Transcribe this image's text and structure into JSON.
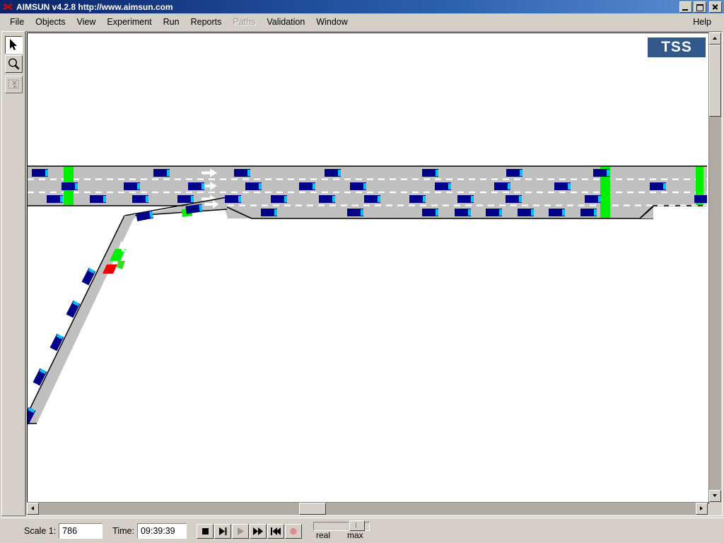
{
  "window": {
    "title": "AIMSUN v4.2.8 http://www.aimsun.com",
    "app_icon": "aimsun-x-icon",
    "controls": {
      "minimize": "minimize-button",
      "restore": "restore-button",
      "close": "close-button"
    }
  },
  "menubar": {
    "items": [
      {
        "label": "File",
        "disabled": false
      },
      {
        "label": "Objects",
        "disabled": false
      },
      {
        "label": "View",
        "disabled": false
      },
      {
        "label": "Experiment",
        "disabled": false
      },
      {
        "label": "Run",
        "disabled": false
      },
      {
        "label": "Reports",
        "disabled": false
      },
      {
        "label": "Paths",
        "disabled": true
      },
      {
        "label": "Validation",
        "disabled": false
      },
      {
        "label": "Window",
        "disabled": false
      }
    ],
    "help_label": "Help"
  },
  "toolpalette": {
    "tools": [
      {
        "name": "select-arrow-tool",
        "icon": "arrow-cursor-icon",
        "state": "pressed"
      },
      {
        "name": "zoom-tool",
        "icon": "magnifier-icon",
        "state": "normal"
      },
      {
        "name": "marquee-tool",
        "icon": "dashed-box-icon",
        "state": "disabled"
      }
    ]
  },
  "canvas": {
    "logo_text": "TSS",
    "logo_color": "#33588c",
    "background": "#ffffff",
    "road_fill": "#c0c0c0",
    "road_stroke": "#000000",
    "vehicle_body": "#00008b",
    "vehicle_window": "#00bfff",
    "detector_green": "#00ee00",
    "signal_red": "#ee0000",
    "lane_marker": "#ffffff",
    "arrow_color": "#ffffff"
  },
  "statusbar": {
    "scale_label": "Scale  1:",
    "scale_value": "786",
    "time_label": "Time:",
    "time_value": "09:39:39",
    "transport": [
      {
        "name": "stop-button",
        "icon": "stop-square-icon",
        "enabled": true
      },
      {
        "name": "step-button",
        "icon": "step-forward-icon",
        "enabled": true
      },
      {
        "name": "play-button",
        "icon": "play-triangle-icon",
        "enabled": false
      },
      {
        "name": "fast-forward-button",
        "icon": "fast-forward-icon",
        "enabled": true
      },
      {
        "name": "rewind-button",
        "icon": "skip-back-icon",
        "enabled": true
      },
      {
        "name": "record-button",
        "icon": "record-circle-icon",
        "enabled": true
      }
    ],
    "speed_slider": {
      "left_label": "real",
      "right_label": "max",
      "value_percent": 70
    }
  },
  "simulation": {
    "mainline": {
      "lane_count_left": 3,
      "lane_count_right": 4,
      "direction": "eastbound",
      "arrow_count": 3
    },
    "onramp": {
      "has_signal": true,
      "signal_state": "red",
      "queued_vehicles": 7
    },
    "detectors": [
      {
        "position": "mainline-upstream"
      },
      {
        "position": "mainline-midstream"
      },
      {
        "position": "mainline-downstream"
      },
      {
        "position": "ramp-merge"
      },
      {
        "position": "ramp-meter"
      }
    ]
  }
}
